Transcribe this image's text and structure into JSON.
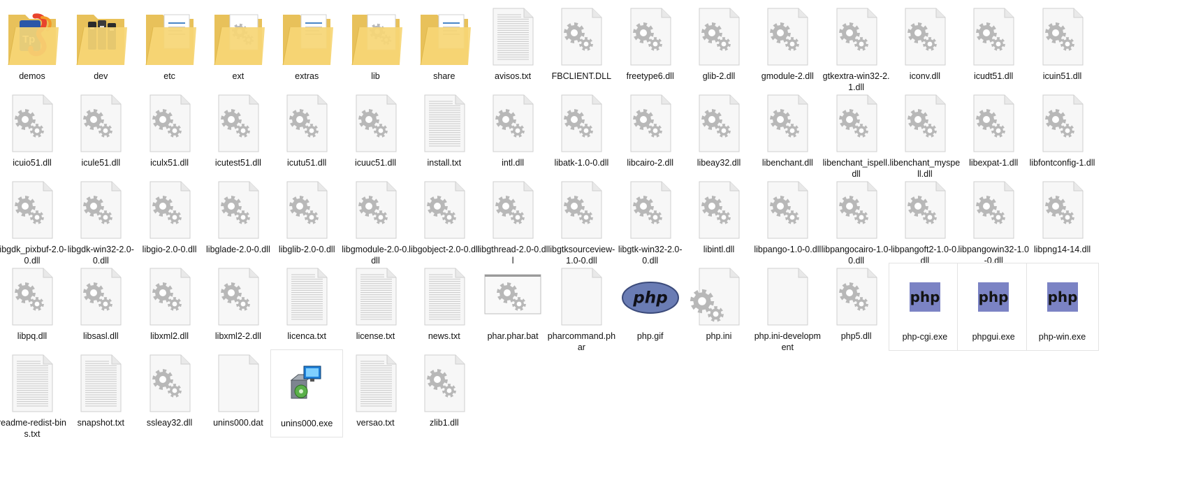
{
  "explorer": {
    "view": "large-icons",
    "items": [
      {
        "label": "demos",
        "type": "folder",
        "preview": "tp-logo"
      },
      {
        "label": "dev",
        "type": "folder",
        "preview": "binders"
      },
      {
        "label": "etc",
        "type": "folder",
        "preview": "doc"
      },
      {
        "label": "ext",
        "type": "folder",
        "preview": "gear"
      },
      {
        "label": "extras",
        "type": "folder",
        "preview": "doc"
      },
      {
        "label": "lib",
        "type": "folder",
        "preview": "gear"
      },
      {
        "label": "share",
        "type": "folder",
        "preview": "doc"
      },
      {
        "label": "avisos.txt",
        "type": "text"
      },
      {
        "label": "FBCLIENT.DLL",
        "type": "dll"
      },
      {
        "label": "freetype6.dll",
        "type": "dll"
      },
      {
        "label": "glib-2.dll",
        "type": "dll"
      },
      {
        "label": "gmodule-2.dll",
        "type": "dll"
      },
      {
        "label": "gtkextra-win32-2.1.dll",
        "type": "dll"
      },
      {
        "label": "iconv.dll",
        "type": "dll"
      },
      {
        "label": "icudt51.dll",
        "type": "dll"
      },
      {
        "label": "icuin51.dll",
        "type": "dll"
      },
      {
        "label": "icuio51.dll",
        "type": "dll"
      },
      {
        "label": "icule51.dll",
        "type": "dll"
      },
      {
        "label": "iculx51.dll",
        "type": "dll"
      },
      {
        "label": "icutest51.dll",
        "type": "dll"
      },
      {
        "label": "icutu51.dll",
        "type": "dll"
      },
      {
        "label": "icuuc51.dll",
        "type": "dll"
      },
      {
        "label": "install.txt",
        "type": "text"
      },
      {
        "label": "intl.dll",
        "type": "dll"
      },
      {
        "label": "libatk-1.0-0.dll",
        "type": "dll"
      },
      {
        "label": "libcairo-2.dll",
        "type": "dll"
      },
      {
        "label": "libeay32.dll",
        "type": "dll"
      },
      {
        "label": "libenchant.dll",
        "type": "dll"
      },
      {
        "label": "libenchant_ispell.dll",
        "type": "dll"
      },
      {
        "label": "libenchant_myspell.dll",
        "type": "dll"
      },
      {
        "label": "libexpat-1.dll",
        "type": "dll"
      },
      {
        "label": "libfontconfig-1.dll",
        "type": "dll"
      },
      {
        "label": "libgdk_pixbuf-2.0-0.dll",
        "type": "dll"
      },
      {
        "label": "libgdk-win32-2.0-0.dll",
        "type": "dll"
      },
      {
        "label": "libgio-2.0-0.dll",
        "type": "dll"
      },
      {
        "label": "libglade-2.0-0.dll",
        "type": "dll"
      },
      {
        "label": "libglib-2.0-0.dll",
        "type": "dll"
      },
      {
        "label": "libgmodule-2.0-0.dll",
        "type": "dll"
      },
      {
        "label": "libgobject-2.0-0.dll",
        "type": "dll"
      },
      {
        "label": "libgthread-2.0-0.dll",
        "type": "dll"
      },
      {
        "label": "libgtksourceview-1.0-0.dll",
        "type": "dll"
      },
      {
        "label": "libgtk-win32-2.0-0.dll",
        "type": "dll"
      },
      {
        "label": "libintl.dll",
        "type": "dll"
      },
      {
        "label": "libpango-1.0-0.dll",
        "type": "dll"
      },
      {
        "label": "libpangocairo-1.0-0.dll",
        "type": "dll"
      },
      {
        "label": "libpangoft2-1.0-0.dll",
        "type": "dll"
      },
      {
        "label": "libpangowin32-1.0-0.dll",
        "type": "dll"
      },
      {
        "label": "libpng14-14.dll",
        "type": "dll"
      },
      {
        "label": "libpq.dll",
        "type": "dll"
      },
      {
        "label": "libsasl.dll",
        "type": "dll"
      },
      {
        "label": "libxml2.dll",
        "type": "dll"
      },
      {
        "label": "libxml2-2.dll",
        "type": "dll"
      },
      {
        "label": "licenca.txt",
        "type": "text"
      },
      {
        "label": "license.txt",
        "type": "text"
      },
      {
        "label": "news.txt",
        "type": "text"
      },
      {
        "label": "phar.phar.bat",
        "type": "bat"
      },
      {
        "label": "pharcommand.phar",
        "type": "blank"
      },
      {
        "label": "php.gif",
        "type": "gif",
        "logo_text": "php"
      },
      {
        "label": "php.ini",
        "type": "ini"
      },
      {
        "label": "php.ini-development",
        "type": "blank"
      },
      {
        "label": "php5.dll",
        "type": "dll"
      },
      {
        "label": "php-cgi.exe",
        "type": "exe-php",
        "logo_text": "php"
      },
      {
        "label": "phpgui.exe",
        "type": "exe-php",
        "logo_text": "php"
      },
      {
        "label": "php-win.exe",
        "type": "exe-php",
        "logo_text": "php"
      },
      {
        "label": "readme-redist-bins.txt",
        "type": "text"
      },
      {
        "label": "snapshot.txt",
        "type": "text"
      },
      {
        "label": "ssleay32.dll",
        "type": "dll"
      },
      {
        "label": "unins000.dat",
        "type": "blank"
      },
      {
        "label": "unins000.exe",
        "type": "exe-setup"
      },
      {
        "label": "versao.txt",
        "type": "text"
      },
      {
        "label": "zlib1.dll",
        "type": "dll"
      }
    ]
  }
}
